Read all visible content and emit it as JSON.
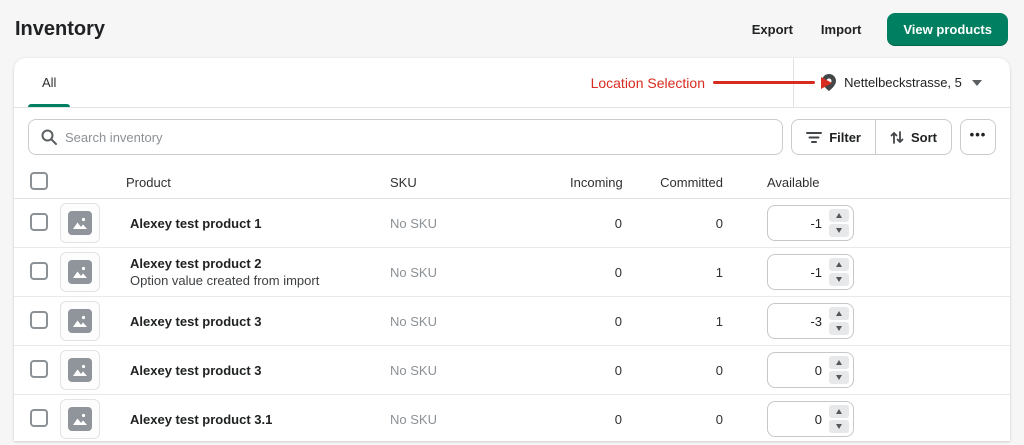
{
  "header": {
    "title": "Inventory",
    "actions": {
      "export": "Export",
      "import": "Import",
      "view_products": "View products"
    }
  },
  "tabs": [
    {
      "label": "All",
      "active": true
    }
  ],
  "location_selector": {
    "label": "Nettelbeckstrasse, 5"
  },
  "annotation": {
    "label": "Location Selection"
  },
  "toolbar": {
    "search_placeholder": "Search inventory",
    "filter_label": "Filter",
    "sort_label": "Sort",
    "more_label": "•••"
  },
  "table": {
    "headers": {
      "product": "Product",
      "sku": "SKU",
      "incoming": "Incoming",
      "committed": "Committed",
      "available": "Available"
    },
    "rows": [
      {
        "product": "Alexey test product 1",
        "subtitle": "",
        "sku": "No SKU",
        "incoming": "0",
        "committed": "0",
        "available": "-1"
      },
      {
        "product": "Alexey test product 2",
        "subtitle": "Option value created from import",
        "sku": "No SKU",
        "incoming": "0",
        "committed": "1",
        "available": "-1"
      },
      {
        "product": "Alexey test product 3",
        "subtitle": "",
        "sku": "No SKU",
        "incoming": "0",
        "committed": "1",
        "available": "-3"
      },
      {
        "product": "Alexey test product 3",
        "subtitle": "",
        "sku": "No SKU",
        "incoming": "0",
        "committed": "0",
        "available": "0"
      },
      {
        "product": "Alexey test product 3.1",
        "subtitle": "",
        "sku": "No SKU",
        "incoming": "0",
        "committed": "0",
        "available": "0"
      }
    ]
  },
  "colors": {
    "accent_green": "#008060",
    "annotation_red": "#d82c20"
  }
}
